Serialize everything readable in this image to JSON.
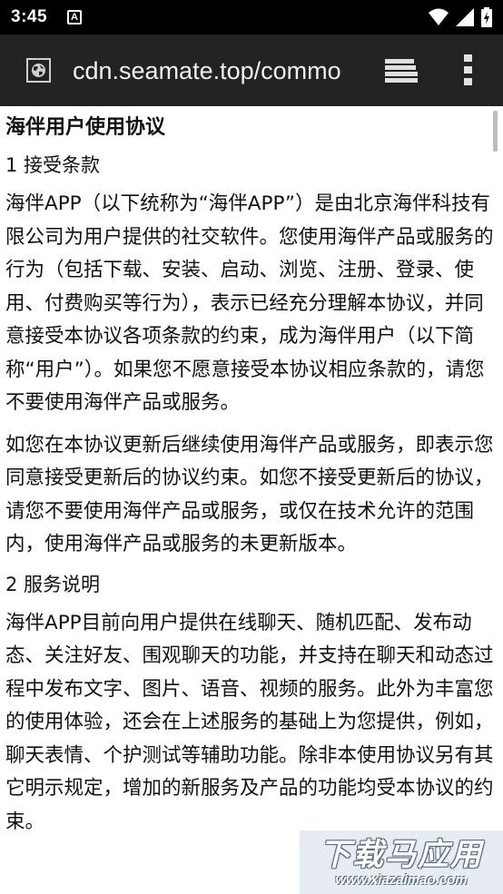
{
  "status_bar": {
    "time": "3:45",
    "notification": "A"
  },
  "toolbar": {
    "url": "cdn.seamate.top/commo"
  },
  "document": {
    "title": "海伴用户使用协议",
    "sections": [
      {
        "heading": "1 接受条款",
        "paragraphs": [
          "海伴APP（以下统称为“海伴APP”）是由北京海伴科技有限公司为用户提供的社交软件。您使用海伴产品或服务的行为（包括下载、安装、启动、浏览、注册、登录、使用、付费购买等行为），表示已经充分理解本协议，并同意接受本协议各项条款的约束，成为海伴用户（以下简称“用户”）。如果您不愿意接受本协议相应条款的，请您不要使用海伴产品或服务。",
          "如您在本协议更新后继续使用海伴产品或服务，即表示您同意接受更新后的协议约束。如您不接受更新后的协议，请您不要使用海伴产品或服务，或仅在技术允许的范围内，使用海伴产品或服务的未更新版本。"
        ]
      },
      {
        "heading": "2 服务说明",
        "paragraphs": [
          "海伴APP目前向用户提供在线聊天、随机匹配、发布动态、关注好友、围观聊天的功能，并支持在聊天和动态过程中发布文字、图片、语音、视频的服务。此外为丰富您的使用体验，还会在上述服务的基础上为您提供，例如，聊天表情、个护测试等辅助功能。除非本使用协议另有其它明示规定，增加的新服务及产品的功能均受本协议的约束。"
        ]
      }
    ]
  },
  "watermark": {
    "title": "下载马应用",
    "url": "www.xiazaimao.com"
  },
  "colors": {
    "status_bar_bg": "#000000",
    "toolbar_bg": "#222222",
    "page_bg": "#ffffff",
    "text": "#111111"
  }
}
